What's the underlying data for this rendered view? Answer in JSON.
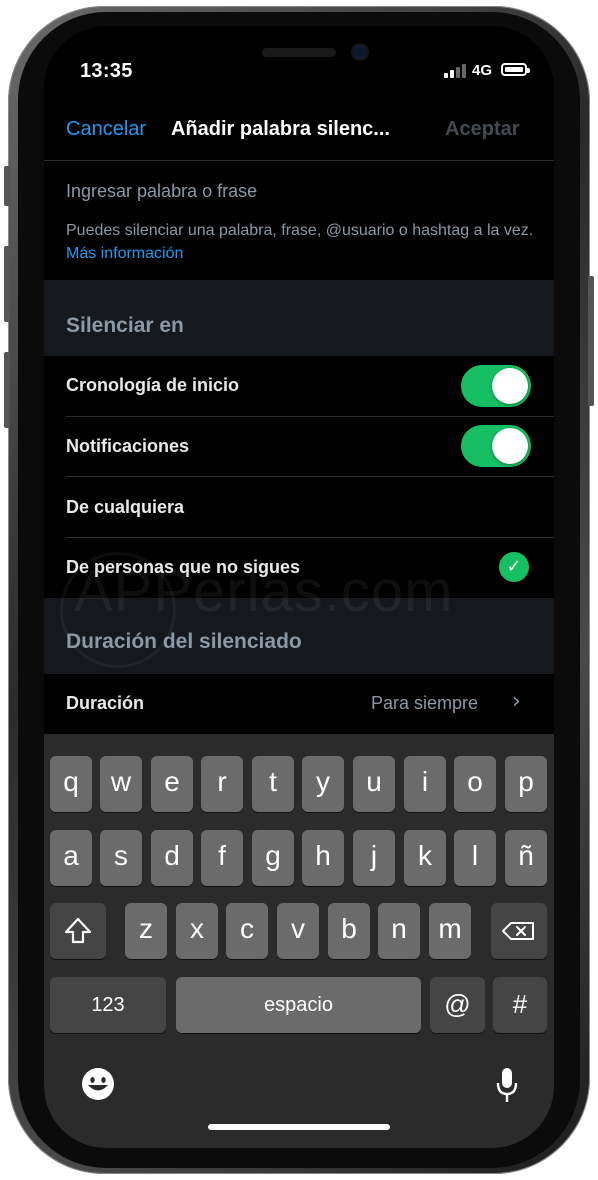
{
  "status_bar": {
    "time": "13:35",
    "network": "4G"
  },
  "nav": {
    "cancel": "Cancelar",
    "title": "Añadir palabra silenc...",
    "accept": "Aceptar"
  },
  "input": {
    "placeholder": "Ingresar palabra o frase"
  },
  "helper": {
    "text": "Puedes silenciar una palabra, frase, @usuario o hashtag a la vez. ",
    "link": "Más información"
  },
  "mute_in": {
    "section_title": "Silenciar en",
    "home_timeline": {
      "label": "Cronología de inicio",
      "enabled": true
    },
    "notifications": {
      "label": "Notificaciones",
      "enabled": true
    },
    "from_anyone": {
      "label": "De cualquiera",
      "selected": false
    },
    "from_non_followed": {
      "label": "De personas que no sigues",
      "selected": true
    }
  },
  "duration": {
    "section_title": "Duración del silenciado",
    "label": "Duración",
    "value": "Para siempre"
  },
  "watermark": "APPerlas.com",
  "keyboard": {
    "row1": [
      "q",
      "w",
      "e",
      "r",
      "t",
      "y",
      "u",
      "i",
      "o",
      "p"
    ],
    "row2": [
      "a",
      "s",
      "d",
      "f",
      "g",
      "h",
      "j",
      "k",
      "l",
      "ñ"
    ],
    "row3": [
      "z",
      "x",
      "c",
      "v",
      "b",
      "n",
      "m"
    ],
    "numbers": "123",
    "space": "espacio",
    "at": "@",
    "hash": "#"
  },
  "colors": {
    "accent": "#1d9bf0",
    "toggle_on": "#17bf63",
    "background": "#000000",
    "section_bg": "#15181c"
  }
}
